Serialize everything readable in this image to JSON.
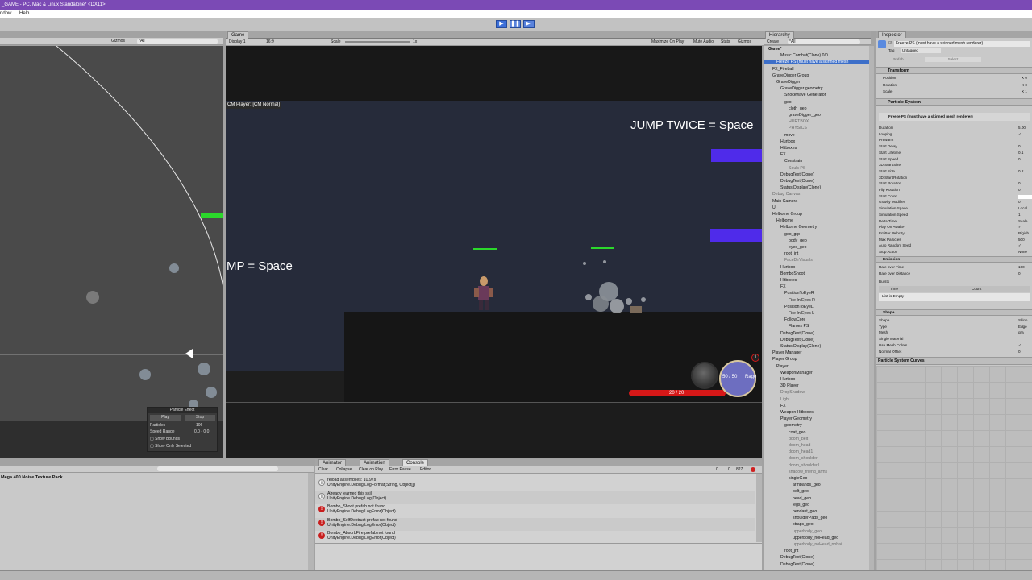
{
  "window": {
    "title": "_GAME - PC, Mac & Linux Standalone* <DX11>",
    "menu": [
      "ndow",
      "Help"
    ]
  },
  "toolbar": {
    "play": "▶",
    "pause": "❚❚",
    "step": "▶|"
  },
  "scene": {
    "gizmos": "Gizmos",
    "search": "*All",
    "particle_effect": {
      "title": "Particle Effect",
      "play": "Play",
      "stop": "Stop",
      "particles_label": "Particles",
      "particles_value": "106",
      "speed_label": "Speed Range",
      "speed_value": "0.0 - 0.0",
      "show_bounds": "Show Bounds",
      "show_selected": "Show Only Selected"
    }
  },
  "game": {
    "tab": "Game",
    "display": "Display 1",
    "aspect": "16:9",
    "scale_label": "Scale",
    "scale_value": "1x",
    "maximize": "Maximize On Play",
    "mute": "Mute Audio",
    "stats": "Stats",
    "gizmos": "Gizmos",
    "cm_label": "CM Player: [CM Normal]",
    "jump_text": "JUMP TWICE = Space",
    "mp_text": "MP = Space",
    "hp_text": "20 / 20",
    "mp_value": "50 / 50",
    "rage": "Rage",
    "level": "1",
    "hp_fraction": 1.0
  },
  "hierarchy": {
    "tab": "Hierarchy",
    "create": "Create",
    "search": "*All",
    "rows": [
      {
        "t": "Game*",
        "d": 0,
        "bold": true
      },
      {
        "t": "Music Combat(Clone) 0/0",
        "d": 3
      },
      {
        "t": "Freeze PS (must have a skinned mesh",
        "d": 2,
        "sel": true
      },
      {
        "t": "FX_Fireball",
        "d": 1
      },
      {
        "t": "GraveDigger Group",
        "d": 1
      },
      {
        "t": "GraveDigger",
        "d": 2
      },
      {
        "t": "GraveDigger geometry",
        "d": 3
      },
      {
        "t": "Shockwave Generator",
        "d": 4
      },
      {
        "t": "geo",
        "d": 4
      },
      {
        "t": "cloth_geo",
        "d": 5
      },
      {
        "t": "graveDigger_geo",
        "d": 5
      },
      {
        "t": "HURTBOX",
        "d": 5,
        "dim": true
      },
      {
        "t": "PHYSICS",
        "d": 5,
        "dim": true
      },
      {
        "t": "move",
        "d": 4
      },
      {
        "t": "Hurtbox",
        "d": 3
      },
      {
        "t": "Hitboxes",
        "d": 3
      },
      {
        "t": "FX",
        "d": 3
      },
      {
        "t": "Constrain",
        "d": 4
      },
      {
        "t": "Souls PS",
        "d": 5,
        "dim": true
      },
      {
        "t": "DebugText(Clone)",
        "d": 3
      },
      {
        "t": "DebugText(Clone)",
        "d": 3
      },
      {
        "t": "Status Display(Clone)",
        "d": 3
      },
      {
        "t": "Debug Canvas",
        "d": 1,
        "dim": true
      },
      {
        "t": "Main Camera",
        "d": 1
      },
      {
        "t": "UI",
        "d": 1
      },
      {
        "t": "Helborne Group",
        "d": 1
      },
      {
        "t": "Helborne",
        "d": 2
      },
      {
        "t": "Helborne Geometry",
        "d": 3
      },
      {
        "t": "geo_grp",
        "d": 4
      },
      {
        "t": "body_geo",
        "d": 5
      },
      {
        "t": "eyes_geo",
        "d": 5
      },
      {
        "t": "root_jnt",
        "d": 4
      },
      {
        "t": "FaceDirVisuals",
        "d": 4,
        "dim": true
      },
      {
        "t": "Hurtbox",
        "d": 3
      },
      {
        "t": "BomboShoot",
        "d": 3
      },
      {
        "t": "Hitboxes",
        "d": 3
      },
      {
        "t": "FX",
        "d": 3
      },
      {
        "t": "PositionToEyeR",
        "d": 4
      },
      {
        "t": "Fire In Eyes R",
        "d": 5
      },
      {
        "t": "PositionToEyeL",
        "d": 4
      },
      {
        "t": "Fire In Eyes L",
        "d": 5
      },
      {
        "t": "FollowCore",
        "d": 4
      },
      {
        "t": "Flames PS",
        "d": 5
      },
      {
        "t": "DebugText(Clone)",
        "d": 3
      },
      {
        "t": "DebugText(Clone)",
        "d": 3
      },
      {
        "t": "Status Display(Clone)",
        "d": 3
      },
      {
        "t": "Player Manager",
        "d": 1
      },
      {
        "t": "Player Group",
        "d": 1
      },
      {
        "t": "Player",
        "d": 2
      },
      {
        "t": "WeaponManager",
        "d": 3
      },
      {
        "t": "Hurtbox",
        "d": 3
      },
      {
        "t": "3D Player",
        "d": 3
      },
      {
        "t": "DropShadow",
        "d": 3,
        "dim": true
      },
      {
        "t": "Light",
        "d": 3,
        "dim": true
      },
      {
        "t": "FX",
        "d": 3
      },
      {
        "t": "Weapon Hitboxes",
        "d": 3
      },
      {
        "t": "Player Geometry",
        "d": 3
      },
      {
        "t": "geometry",
        "d": 4
      },
      {
        "t": "coat_geo",
        "d": 5
      },
      {
        "t": "doom_belt",
        "d": 5,
        "dim": true
      },
      {
        "t": "doom_head",
        "d": 5,
        "dim": true
      },
      {
        "t": "doom_head1",
        "d": 5,
        "dim": true
      },
      {
        "t": "doom_shoulder",
        "d": 5,
        "dim": true
      },
      {
        "t": "doom_shoulder1",
        "d": 5,
        "dim": true
      },
      {
        "t": "shadow_friend_arms",
        "d": 5,
        "dim": true
      },
      {
        "t": "singleGeo",
        "d": 5
      },
      {
        "t": "armbands_geo",
        "d": 6
      },
      {
        "t": "belt_geo",
        "d": 6
      },
      {
        "t": "head_geo",
        "d": 6
      },
      {
        "t": "legs_geo",
        "d": 6
      },
      {
        "t": "pendant_geo",
        "d": 6
      },
      {
        "t": "shoulderPads_geo",
        "d": 6
      },
      {
        "t": "straps_geo",
        "d": 6
      },
      {
        "t": "upperbody_geo",
        "d": 6,
        "dim": true
      },
      {
        "t": "upperbody_noHead_geo",
        "d": 6
      },
      {
        "t": "upperbody_noHead_nohai",
        "d": 6,
        "dim": true
      },
      {
        "t": "root_jnt",
        "d": 4
      },
      {
        "t": "DebugText(Clone)",
        "d": 3
      },
      {
        "t": "DebugText(Clone)",
        "d": 3
      }
    ]
  },
  "inspector": {
    "tab": "Inspector",
    "object_name": "Freeze PS (must have a skinned mesh renderer)",
    "tag_label": "Tag",
    "tag_value": "Untagged",
    "prefab_label": "Prefab",
    "prefab_select": "Select",
    "transform": "Transform",
    "transform_rows": [
      "Position",
      "Rotation",
      "Scale"
    ],
    "transform_vals": [
      "X 0",
      "X 0",
      "X 1"
    ],
    "particle_system": "Particle System",
    "ps_name": "Freeze PS (must have a skinned mesh renderer)",
    "ps_rows": [
      [
        "Duration",
        "5.00"
      ],
      [
        "Looping",
        "✓"
      ],
      [
        "Prewarm",
        ""
      ],
      [
        "Start Delay",
        "0"
      ],
      [
        "Start Lifetime",
        "0.1"
      ],
      [
        "Start Speed",
        "0"
      ],
      [
        "3D Start Size",
        ""
      ],
      [
        "Start Size",
        "0.2"
      ],
      [
        "3D Start Rotation",
        ""
      ],
      [
        "Start Rotation",
        "0"
      ],
      [
        "Flip Rotation",
        "0"
      ],
      [
        "Start Color",
        ""
      ],
      [
        "Gravity Modifier",
        "0"
      ],
      [
        "Simulation Space",
        "Local"
      ],
      [
        "Simulation Speed",
        "1"
      ],
      [
        "Delta Time",
        "Scale"
      ],
      [
        "Play On Awake*",
        "✓"
      ],
      [
        "Emitter Velocity",
        "Rigidb"
      ],
      [
        "Max Particles",
        "500"
      ],
      [
        "Auto Random Seed",
        "✓"
      ],
      [
        "Stop Action",
        "None"
      ]
    ],
    "emission": "Emission",
    "emission_rows": [
      [
        "Rate over Time",
        "100"
      ],
      [
        "Rate over Distance",
        "0"
      ]
    ],
    "bursts": "Bursts",
    "bursts_time": "Time",
    "bursts_count": "Count",
    "list_empty": "List is Empty",
    "shape": "Shape",
    "shape_rows": [
      [
        "Shape",
        "Skinn"
      ],
      [
        "Type",
        "Edge"
      ],
      [
        "Mesh",
        "gra"
      ],
      [
        "Single Material",
        ""
      ],
      [
        "Use Mesh Colors",
        "✓"
      ],
      [
        "Normal Offset",
        "0"
      ]
    ],
    "curves": "Particle System Curves"
  },
  "project": {
    "item": "Mega 400 Noise Texture Pack"
  },
  "console": {
    "tabs": [
      "Animator",
      "Animation",
      "Console"
    ],
    "buttons": [
      "Clear",
      "Collapse",
      "Clear on Play",
      "Error Pause",
      "Editor"
    ],
    "count_warn": "0",
    "count_err": "827",
    "count_log": "0",
    "rows": [
      {
        "type": "info",
        "l1": "reload assemblies: 10.97s",
        "l2": "UnityEngine.Debug:LogFormat(String, Object[])"
      },
      {
        "type": "info",
        "l1": "Already learned this skill",
        "l2": "UnityEngine.Debug:Log(Object)"
      },
      {
        "type": "error",
        "l1": "Bombo_Shoot prefab not found",
        "l2": "UnityEngine.Debug:LogError(Object)"
      },
      {
        "type": "error",
        "l1": "Bombo_SelfDestruct prefab not found",
        "l2": "UnityEngine.Debug:LogError(Object)"
      },
      {
        "type": "error",
        "l1": "Bombo_AbsorbFire prefab not found",
        "l2": "UnityEngine.Debug:LogError(Object)"
      }
    ]
  }
}
